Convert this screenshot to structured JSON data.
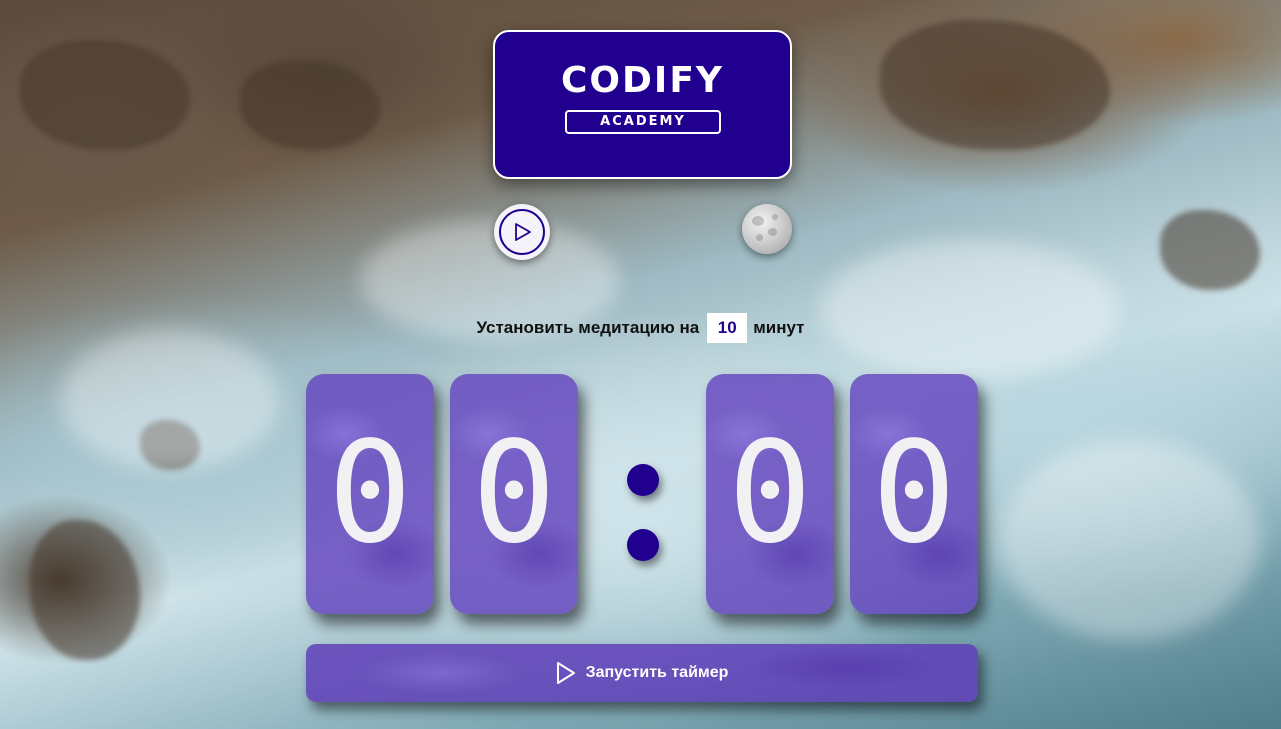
{
  "logo": {
    "word": "CODIFY",
    "sub": "ACADEMY"
  },
  "controls": {
    "play_icon": "play-outline-icon",
    "moon_icon": "moon-icon"
  },
  "meditation": {
    "prefix": "Установить медитацию на",
    "minutes_value": "10",
    "suffix": "минут"
  },
  "timer": {
    "digits": [
      "0",
      "0",
      "0",
      "0"
    ]
  },
  "start_button": {
    "label": "Запустить таймер",
    "icon": "play-outline-icon"
  },
  "colors": {
    "brand": "#22008f",
    "card": "#6444be"
  }
}
